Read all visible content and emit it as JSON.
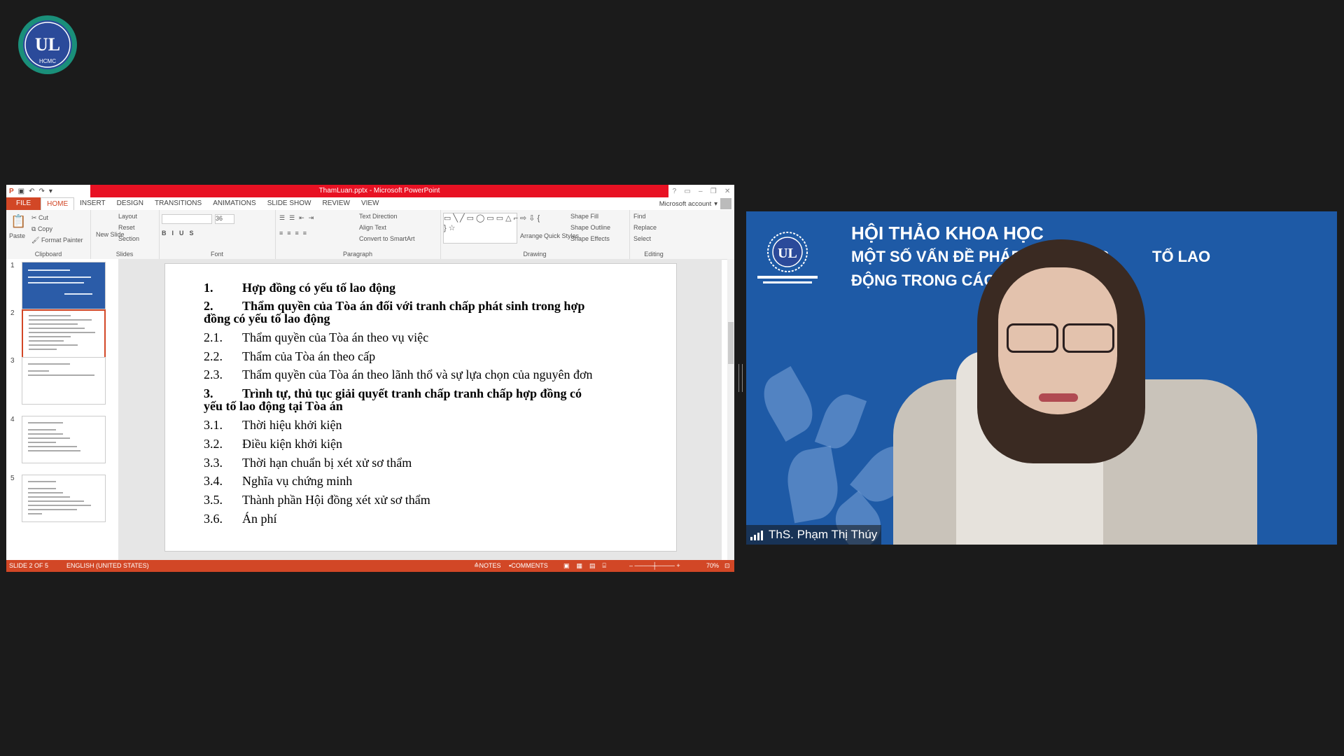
{
  "logo": {
    "text": "HCMC",
    "monogram": "UL"
  },
  "ppt": {
    "title": "ThamLuan.pptx - Microsoft PowerPoint",
    "tabs": [
      "FILE",
      "HOME",
      "INSERT",
      "DESIGN",
      "TRANSITIONS",
      "ANIMATIONS",
      "SLIDE SHOW",
      "REVIEW",
      "VIEW"
    ],
    "active_tab": "HOME",
    "account": "Microsoft account",
    "ribbon": {
      "clipboard": {
        "label": "Clipboard",
        "paste": "Paste",
        "cut": "Cut",
        "copy": "Copy",
        "format_painter": "Format Painter"
      },
      "slides": {
        "label": "Slides",
        "new_slide": "New Slide",
        "layout": "Layout",
        "reset": "Reset",
        "section": "Section"
      },
      "font": {
        "label": "Font",
        "size": "36"
      },
      "paragraph": {
        "label": "Paragraph",
        "text_direction": "Text Direction",
        "align_text": "Align Text",
        "convert": "Convert to SmartArt"
      },
      "drawing": {
        "label": "Drawing",
        "arrange": "Arrange",
        "quick_styles": "Quick Styles",
        "shape_fill": "Shape Fill",
        "shape_outline": "Shape Outline",
        "shape_effects": "Shape Effects"
      },
      "editing": {
        "label": "Editing",
        "find": "Find",
        "replace": "Replace",
        "select": "Select"
      }
    },
    "thumbnails": [
      "1",
      "2",
      "3",
      "4",
      "5"
    ],
    "slide_lines": [
      {
        "num": "1.",
        "text": "Hợp đồng có yếu tố lao động",
        "bold": true
      },
      {
        "num": "2.",
        "text": "Thẩm quyền của Tòa án đối với tranh chấp phát sinh trong hợp",
        "bold": true
      },
      {
        "num": "",
        "text": "đồng có yếu tố lao động",
        "bold": true
      },
      {
        "num": "2.1.",
        "text": "Thẩm quyền của Tòa án theo vụ việc",
        "bold": false
      },
      {
        "num": "2.2.",
        "text": "Thẩm của Tòa án theo cấp",
        "bold": false
      },
      {
        "num": "2.3.",
        "text": "Thẩm quyền của Tòa án theo lãnh thổ và sự lựa chọn của nguyên đơn",
        "bold": false
      },
      {
        "num": "3.",
        "text": "Trình tự, thủ tục giải quyết tranh chấp tranh chấp hợp đồng có",
        "bold": true
      },
      {
        "num": "",
        "text": "yếu tố lao động tại Tòa án",
        "bold": true
      },
      {
        "num": "3.1.",
        "text": "Thời hiệu khởi kiện",
        "bold": false
      },
      {
        "num": "3.2.",
        "text": "Điều kiện khởi kiện",
        "bold": false
      },
      {
        "num": "3.3.",
        "text": "Thời hạn chuẩn bị xét xử sơ thẩm",
        "bold": false
      },
      {
        "num": "3.4.",
        "text": "Nghĩa vụ chứng minh",
        "bold": false
      },
      {
        "num": "3.5.",
        "text": "Thành phần Hội đồng xét xử sơ thẩm",
        "bold": false
      },
      {
        "num": "3.6.",
        "text": "Án phí",
        "bold": false
      }
    ],
    "status": {
      "slide": "SLIDE 2 OF 5",
      "language": "ENGLISH (UNITED STATES)",
      "notes": "NOTES",
      "comments": "COMMENTS",
      "zoom": "70%"
    }
  },
  "video": {
    "banner_line1": "HỘI THẢO KHOA HỌC",
    "banner_line2": "MỘT SỐ VẤN ĐỀ PHÁP LÝ VỀ HỢP",
    "banner_line2b": "TỐ LAO",
    "banner_line3": "ĐỘNG TRONG CÁC QUAN HỆ D",
    "participant": "ThS. Phạm Thị Thúy"
  },
  "colors": {
    "ppt_accent": "#d24726",
    "video_bg": "#1e5aa6"
  }
}
